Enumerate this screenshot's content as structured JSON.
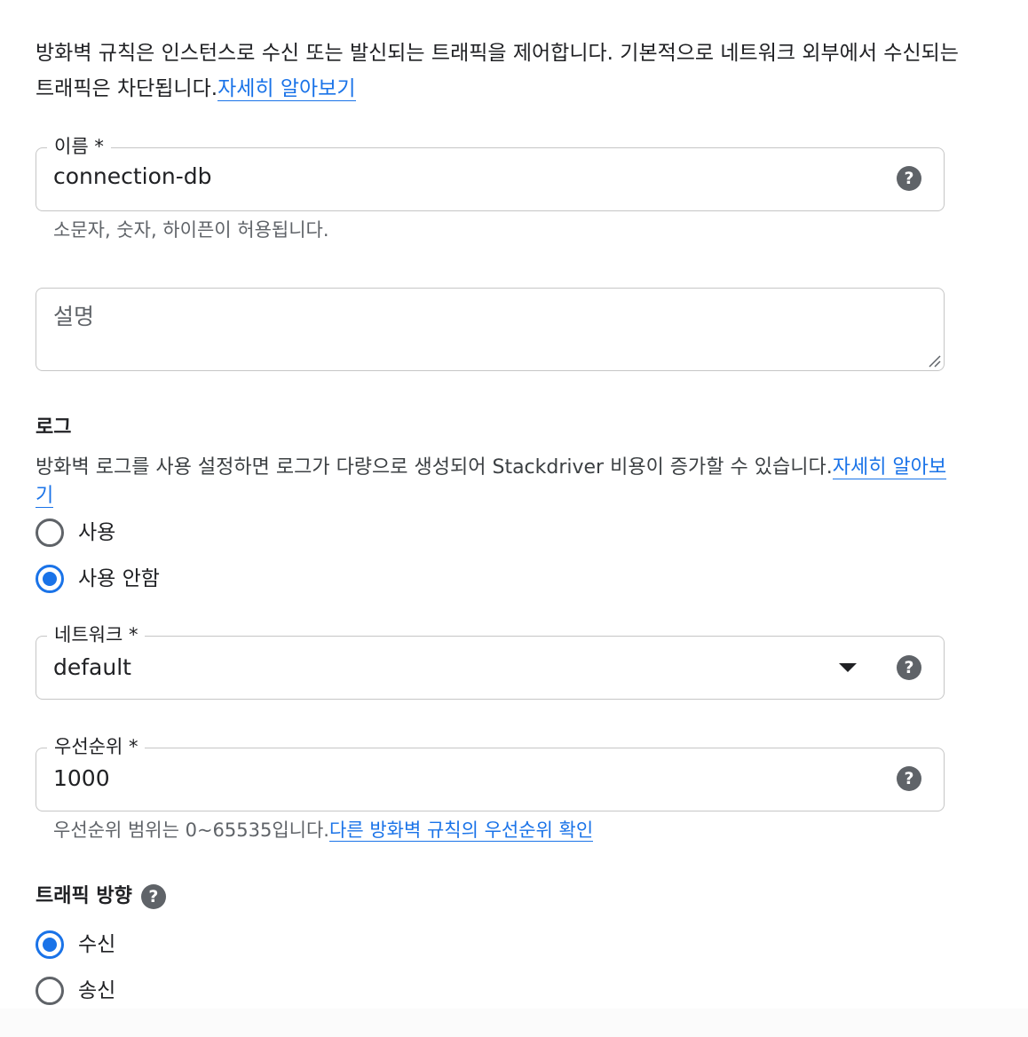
{
  "intro": {
    "text": "방화벽 규칙은 인스턴스로 수신 또는 발신되는 트래픽을 제어합니다. 기본적으로 네트워크 외부에서 수신되는 트래픽은 차단됩니다.",
    "link": "자세히 알아보기"
  },
  "name_field": {
    "label": "이름 *",
    "value": "connection-db",
    "hint": "소문자, 숫자, 하이픈이 허용됩니다."
  },
  "description_field": {
    "placeholder": "설명"
  },
  "logs": {
    "title": "로그",
    "description": "방화벽 로그를 사용 설정하면 로그가 다량으로 생성되어 Stackdriver 비용이 증가할 수 있습니다.",
    "link": "자세히 알아보기",
    "options": [
      {
        "label": "사용",
        "checked": false
      },
      {
        "label": "사용 안함",
        "checked": true
      }
    ]
  },
  "network_field": {
    "label": "네트워크 *",
    "value": "default"
  },
  "priority_field": {
    "label": "우선순위 *",
    "value": "1000",
    "hint": "우선순위 범위는 0~65535입니다.",
    "hint_link": "다른 방화벽 규칙의 우선순위 확인"
  },
  "traffic_direction": {
    "title": "트래픽 방향",
    "options": [
      {
        "label": "수신",
        "checked": true
      },
      {
        "label": "송신",
        "checked": false
      }
    ]
  },
  "icons": {
    "help": "help-icon",
    "dropdown": "arrow-drop-down-icon",
    "resize": "resize-grip-icon"
  },
  "colors": {
    "accent": "#1a73e8",
    "border": "#c6c6c6",
    "icon": "#5f6368",
    "text": "#202124"
  }
}
